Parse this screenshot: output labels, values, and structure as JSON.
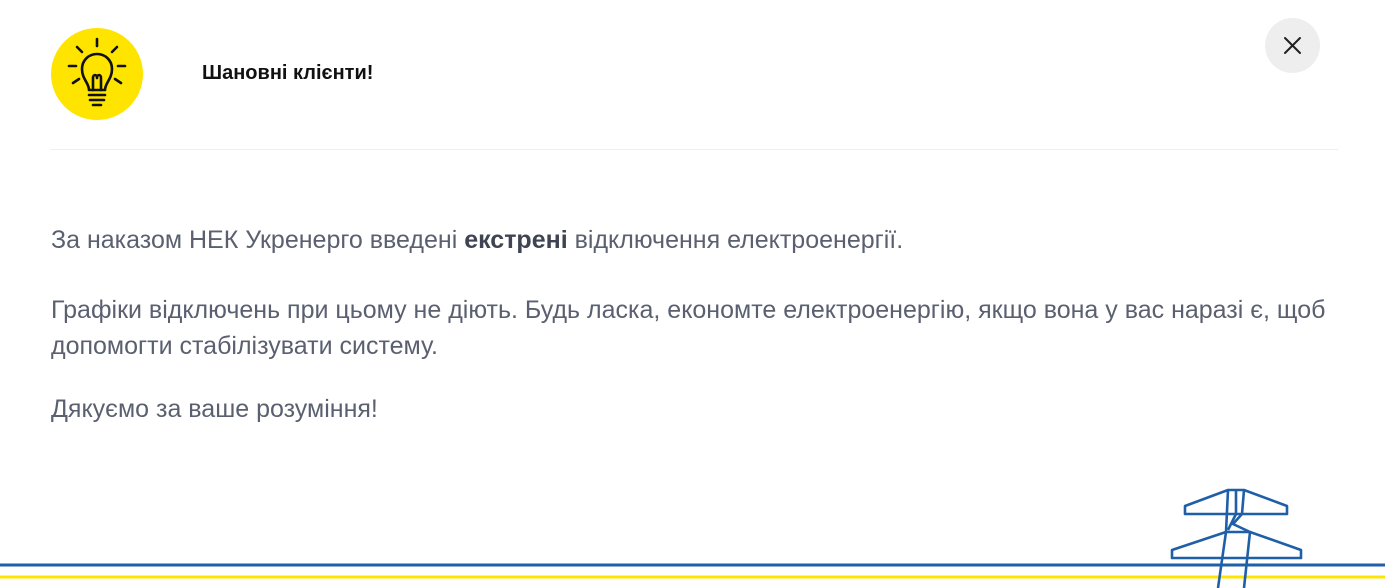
{
  "modal": {
    "title": "Шановні клієнти!",
    "icon": "lightbulb-icon",
    "close_icon": "close-icon",
    "paragraph1": {
      "before": "За наказом НЕК Укренерго введені ",
      "emphasis": "екстрені",
      "after": " відключення електроенергії."
    },
    "paragraph2": "Графіки відключень при цьому не діють.  Будь ласка, економте електроенергію, якщо вона у вас наразі є, щоб допомогти стабілізувати систему.",
    "paragraph3": "Дякуємо за ваше розуміння!"
  },
  "colors": {
    "badge_yellow": "#FFE400",
    "line_blue": "#1F5FA8",
    "line_yellow": "#FFE400",
    "text": "#5A6070",
    "close_bg": "#EEEEEE"
  },
  "decor": {
    "icon": "power-tower-icon"
  }
}
